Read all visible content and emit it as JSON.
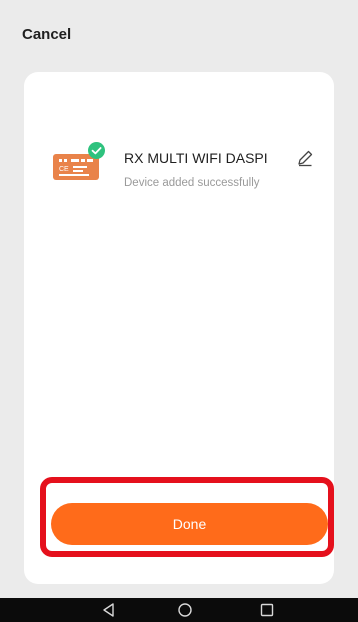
{
  "header": {
    "cancel_label": "Cancel"
  },
  "device": {
    "name": "RX MULTI WIFI DASPI",
    "status": "Device added successfully",
    "icon": "device-module-icon",
    "badge_icon": "check-circle-icon",
    "edit_icon": "pencil-icon"
  },
  "actions": {
    "done_label": "Done"
  },
  "navbar": {
    "buttons": [
      "back-triangle-icon",
      "home-circle-icon",
      "recents-square-icon"
    ]
  },
  "colors": {
    "background": "#ebebeb",
    "card": "#ffffff",
    "accent": "#ff6b1a",
    "highlight": "#e5101c",
    "success": "#2ec27e",
    "navbar": "#0b0b0b"
  }
}
